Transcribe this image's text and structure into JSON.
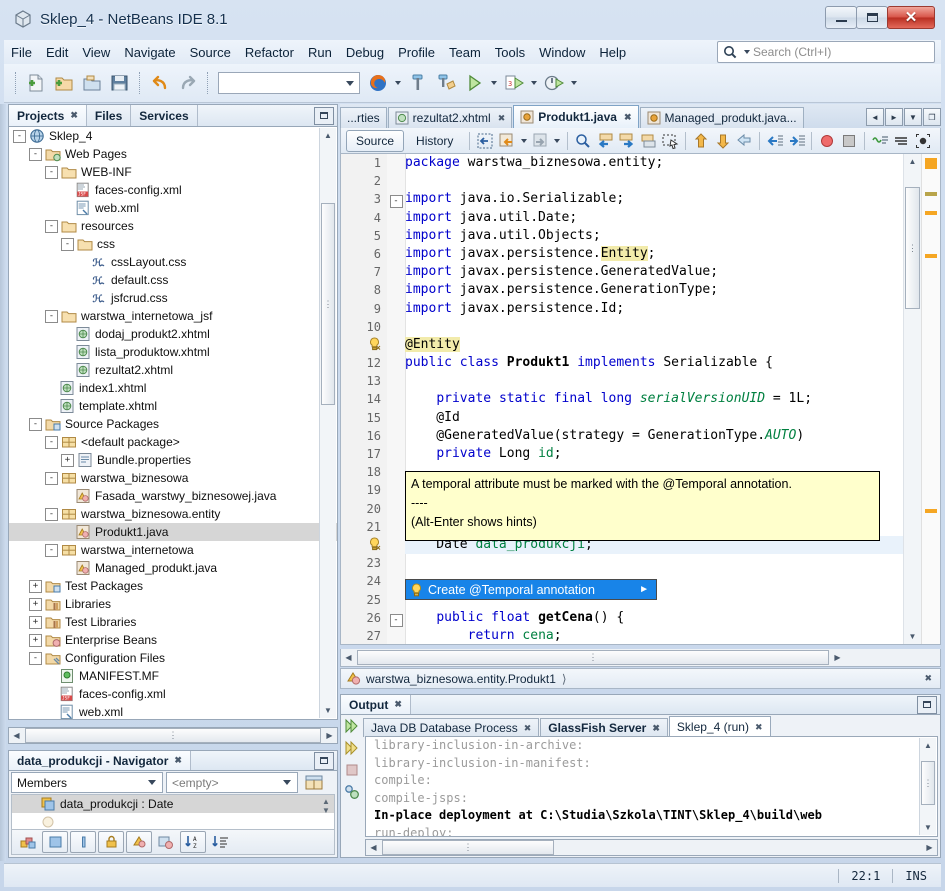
{
  "window": {
    "title": "Sklep_4 - NetBeans IDE 8.1",
    "app_icon": "netbeans-cube-icon",
    "minimize": "minimize-button",
    "maximize": "maximize-button",
    "close": "close-button"
  },
  "menubar": {
    "items": [
      "File",
      "Edit",
      "View",
      "Navigate",
      "Source",
      "Refactor",
      "Run",
      "Debug",
      "Profile",
      "Team",
      "Tools",
      "Window",
      "Help"
    ],
    "search_placeholder": "Search (Ctrl+I)",
    "search_value": ""
  },
  "toolbar": {
    "buttons": [
      {
        "name": "new-file-icon",
        "label": "New File"
      },
      {
        "name": "new-project-icon",
        "label": "New Project"
      },
      {
        "name": "open-project-icon",
        "label": "Open Project"
      },
      {
        "name": "save-all-icon",
        "label": "Save All"
      },
      {
        "name": "undo-icon",
        "label": "Undo"
      },
      {
        "name": "redo-icon",
        "label": "Redo"
      },
      {
        "name": "browser-firefox-icon",
        "label": "Firefox"
      },
      {
        "name": "build-hammer-icon",
        "label": "Build Project"
      },
      {
        "name": "clean-build-icon",
        "label": "Clean and Build Project"
      },
      {
        "name": "run-project-icon",
        "label": "Run Project"
      },
      {
        "name": "debug-project-icon",
        "label": "Debug Project"
      },
      {
        "name": "profile-project-icon",
        "label": "Profile Project"
      }
    ],
    "config_combo_value": ""
  },
  "left_panel": {
    "tabs": [
      {
        "label": "Projects",
        "active": true,
        "closable": true
      },
      {
        "label": "Files",
        "active": false,
        "closable": false
      },
      {
        "label": "Services",
        "active": false,
        "closable": false
      }
    ],
    "minimize_label": "Minimize Window",
    "tree": [
      {
        "indent": 0,
        "toggle": "-",
        "icon": "project-globe-icon",
        "label": "Sklep_4",
        "selected": false
      },
      {
        "indent": 1,
        "toggle": "-",
        "icon": "web-pages-folder-icon",
        "label": "Web Pages",
        "selected": false
      },
      {
        "indent": 2,
        "toggle": "-",
        "icon": "folder-icon",
        "label": "WEB-INF",
        "selected": false
      },
      {
        "indent": 3,
        "toggle": "",
        "icon": "jsf-xml-icon",
        "label": "faces-config.xml",
        "selected": false
      },
      {
        "indent": 3,
        "toggle": "",
        "icon": "xml-icon",
        "label": "web.xml",
        "selected": false
      },
      {
        "indent": 2,
        "toggle": "-",
        "icon": "folder-icon",
        "label": "resources",
        "selected": false
      },
      {
        "indent": 3,
        "toggle": "-",
        "icon": "folder-icon",
        "label": "css",
        "selected": false
      },
      {
        "indent": 4,
        "toggle": "",
        "icon": "css-icon",
        "label": "cssLayout.css",
        "selected": false
      },
      {
        "indent": 4,
        "toggle": "",
        "icon": "css-icon",
        "label": "default.css",
        "selected": false
      },
      {
        "indent": 4,
        "toggle": "",
        "icon": "css-icon",
        "label": "jsfcrud.css",
        "selected": false
      },
      {
        "indent": 2,
        "toggle": "-",
        "icon": "folder-icon",
        "label": "warstwa_internetowa_jsf",
        "selected": false
      },
      {
        "indent": 3,
        "toggle": "",
        "icon": "xhtml-icon",
        "label": "dodaj_produkt2.xhtml",
        "selected": false
      },
      {
        "indent": 3,
        "toggle": "",
        "icon": "xhtml-icon",
        "label": "lista_produktow.xhtml",
        "selected": false
      },
      {
        "indent": 3,
        "toggle": "",
        "icon": "xhtml-icon",
        "label": "rezultat2.xhtml",
        "selected": false
      },
      {
        "indent": 2,
        "toggle": "",
        "icon": "xhtml-icon",
        "label": "index1.xhtml",
        "selected": false
      },
      {
        "indent": 2,
        "toggle": "",
        "icon": "xhtml-icon",
        "label": "template.xhtml",
        "selected": false
      },
      {
        "indent": 1,
        "toggle": "-",
        "icon": "source-packages-icon",
        "label": "Source Packages",
        "selected": false
      },
      {
        "indent": 2,
        "toggle": "-",
        "icon": "package-icon",
        "label": "<default package>",
        "selected": false
      },
      {
        "indent": 3,
        "toggle": "+",
        "icon": "properties-icon",
        "label": "Bundle.properties",
        "selected": false
      },
      {
        "indent": 2,
        "toggle": "-",
        "icon": "package-icon",
        "label": "warstwa_biznesowa",
        "selected": false
      },
      {
        "indent": 3,
        "toggle": "",
        "icon": "java-file-icon",
        "label": "Fasada_warstwy_biznesowej.java",
        "selected": false
      },
      {
        "indent": 2,
        "toggle": "-",
        "icon": "package-icon",
        "label": "warstwa_biznesowa.entity",
        "selected": false
      },
      {
        "indent": 3,
        "toggle": "",
        "icon": "java-file-icon",
        "label": "Produkt1.java",
        "selected": true
      },
      {
        "indent": 2,
        "toggle": "-",
        "icon": "package-icon",
        "label": "warstwa_internetowa",
        "selected": false
      },
      {
        "indent": 3,
        "toggle": "",
        "icon": "java-file-icon",
        "label": "Managed_produkt.java",
        "selected": false
      },
      {
        "indent": 1,
        "toggle": "+",
        "icon": "test-packages-icon",
        "label": "Test Packages",
        "selected": false
      },
      {
        "indent": 1,
        "toggle": "+",
        "icon": "libraries-icon",
        "label": "Libraries",
        "selected": false
      },
      {
        "indent": 1,
        "toggle": "+",
        "icon": "libraries-icon",
        "label": "Test Libraries",
        "selected": false
      },
      {
        "indent": 1,
        "toggle": "+",
        "icon": "enterprise-beans-icon",
        "label": "Enterprise Beans",
        "selected": false
      },
      {
        "indent": 1,
        "toggle": "-",
        "icon": "config-files-icon",
        "label": "Configuration Files",
        "selected": false
      },
      {
        "indent": 2,
        "toggle": "",
        "icon": "manifest-icon",
        "label": "MANIFEST.MF",
        "selected": false
      },
      {
        "indent": 2,
        "toggle": "",
        "icon": "jsf-xml-icon",
        "label": "faces-config.xml",
        "selected": false
      },
      {
        "indent": 2,
        "toggle": "",
        "icon": "xml-icon",
        "label": "web.xml",
        "selected": false
      }
    ]
  },
  "navigator": {
    "title": "data_produkcji - Navigator",
    "minimize_label": "Minimize Window",
    "filter_combo": "Members",
    "scope_combo": "<empty>",
    "member": "data_produkcji : Date",
    "toolbar_buttons": [
      {
        "name": "show-inherited-members-icon"
      },
      {
        "name": "show-public-icon"
      },
      {
        "name": "show-protected-icon"
      },
      {
        "name": "show-package-private-icon"
      },
      {
        "name": "show-private-icon"
      },
      {
        "name": "show-static-icon"
      },
      {
        "name": "sort-alphabetically-icon"
      },
      {
        "name": "sort-by-source-icon"
      }
    ]
  },
  "editor": {
    "tabs": [
      {
        "label": "...rties",
        "icon": "",
        "active": false,
        "closable": false
      },
      {
        "label": "rezultat2.xhtml",
        "icon": "xhtml-icon",
        "active": false,
        "closable": true
      },
      {
        "label": "Produkt1.java",
        "icon": "java-file-icon",
        "active": true,
        "closable": true
      },
      {
        "label": "Managed_produkt.java...",
        "icon": "java-file-icon",
        "active": false,
        "closable": false
      }
    ],
    "tab_nav": [
      "◄",
      "►",
      "▼",
      "❐"
    ],
    "mode_buttons": [
      {
        "label": "Source",
        "active": true
      },
      {
        "label": "History",
        "active": false
      }
    ],
    "toolbar_icons": [
      "last-edit-icon",
      "back-icon",
      "forward-icon",
      "find-selection-icon",
      "previous-bookmark-icon",
      "next-bookmark-icon",
      "toggle-bookmark-icon",
      "rectangular-selection-icon",
      "previous-error-icon",
      "next-error-icon",
      "shift-line-icon",
      "shift-left-icon",
      "shift-right-icon",
      "toggle-breakpoint-icon",
      "stop-icon",
      "toggle-highlight-icon",
      "toggle-non-printable-icon",
      "inspect-members-icon"
    ],
    "code_lines": [
      {
        "n": "1",
        "html": "<span class='kw'>package</span> warstwa_biznesowa.entity;"
      },
      {
        "n": "2",
        "html": ""
      },
      {
        "n": "3",
        "html": "<span class='kw'>import</span> java.io.Serializable;",
        "fold": "-"
      },
      {
        "n": "4",
        "html": "<span class='kw'>import</span> java.util.Date;"
      },
      {
        "n": "5",
        "html": "<span class='kw'>import</span> java.util.Objects;"
      },
      {
        "n": "6",
        "html": "<span class='kw'>import</span> javax.persistence.<span class='hl'>Entity</span>;"
      },
      {
        "n": "7",
        "html": "<span class='kw'>import</span> javax.persistence.GeneratedValue;"
      },
      {
        "n": "8",
        "html": "<span class='kw'>import</span> javax.persistence.GenerationType;"
      },
      {
        "n": "9",
        "html": "<span class='kw'>import</span> javax.persistence.Id;"
      },
      {
        "n": "10",
        "html": ""
      },
      {
        "n": "",
        "html": "<span class='hl'>@Entity</span>",
        "glyph": "warning-bulb-icon"
      },
      {
        "n": "12",
        "html": "<span class='kw'>public</span> <span class='kw'>class</span> <b>Produkt1</b> <span class='kw'>implements</span> Serializable {"
      },
      {
        "n": "13",
        "html": ""
      },
      {
        "n": "14",
        "html": "    <span class='kw'>private</span> <span class='kw'>static</span> <span class='kw'>final</span> <span class='kw'>long</span> <span class='ital'>serialVersionUID</span> = 1L;"
      },
      {
        "n": "15",
        "html": "    @Id"
      },
      {
        "n": "16",
        "html": "    @GeneratedValue(strategy = GenerationType.<span class='ital'>AUTO</span>)"
      },
      {
        "n": "17",
        "html": "    <span class='kw'>private</span> Long <span class='fld'>id</span>;"
      },
      {
        "n": "18",
        "html": ""
      },
      {
        "n": "19",
        "html": ""
      },
      {
        "n": "20",
        "html": ""
      },
      {
        "n": "21",
        "html": ""
      },
      {
        "n": "",
        "html": "    Date <span class='fld'>data_produkcji</span>;",
        "glyph": "warning-bulb-icon",
        "current": true
      },
      {
        "n": "23",
        "html": ""
      },
      {
        "n": "24",
        "html": ""
      },
      {
        "n": "25",
        "html": ""
      },
      {
        "n": "26",
        "html": "    <span class='kw'>public</span> <span class='kw'>float</span> <b>getCena</b>() {",
        "fold": "-"
      },
      {
        "n": "27",
        "html": "        <span class='kw'>return</span> <span class='fld'>cena</span>;"
      }
    ],
    "error_tooltip": {
      "line1": "A temporal attribute must be marked with the @Temporal annotation.",
      "line2": "----",
      "line3": "(Alt-Enter shows hints)"
    },
    "hint_popup": {
      "label": "Create @Temporal annotation",
      "icon": "lightbulb-icon",
      "submenu_arrow": "►"
    },
    "breadcrumb": "warstwa_biznesowa.entity.Produkt1",
    "breadcrumb_icon": "java-class-icon",
    "breadcrumb_arrow": "⟩"
  },
  "output": {
    "title": "Output",
    "minimize_label": "Minimize Window",
    "rail_buttons": [
      {
        "name": "rerun-icon"
      },
      {
        "name": "rerun-alt-icon"
      },
      {
        "name": "stop-icon"
      },
      {
        "name": "settings-icon"
      }
    ],
    "tabs": [
      {
        "label": "Java DB Database Process",
        "active": false,
        "bold": false,
        "closable": true
      },
      {
        "label": "GlassFish Server",
        "active": false,
        "bold": true,
        "closable": true
      },
      {
        "label": "Sklep_4 (run)",
        "active": true,
        "bold": false,
        "closable": true
      }
    ],
    "lines": [
      {
        "text": "library-inclusion-in-archive:",
        "bold": false
      },
      {
        "text": "library-inclusion-in-manifest:",
        "bold": false
      },
      {
        "text": "compile:",
        "bold": false
      },
      {
        "text": "compile-jsps:",
        "bold": false
      },
      {
        "text": "In-place deployment at C:\\Studia\\Szkola\\TINT\\Sklep_4\\build\\web",
        "bold": true
      },
      {
        "text": "run-deploy:",
        "bold": false
      }
    ]
  },
  "statusbar": {
    "caret_position": "22:1",
    "insert_mode": "INS"
  },
  "colors": {
    "accent_blue": "#1884e8",
    "highlight_yellow": "#f2ebab",
    "tooltip_yellow": "#ffffcc",
    "keyword_blue": "#0000cc",
    "field_green": "#008040",
    "error_orange": "#f5a623",
    "close_red": "#b92f22"
  }
}
